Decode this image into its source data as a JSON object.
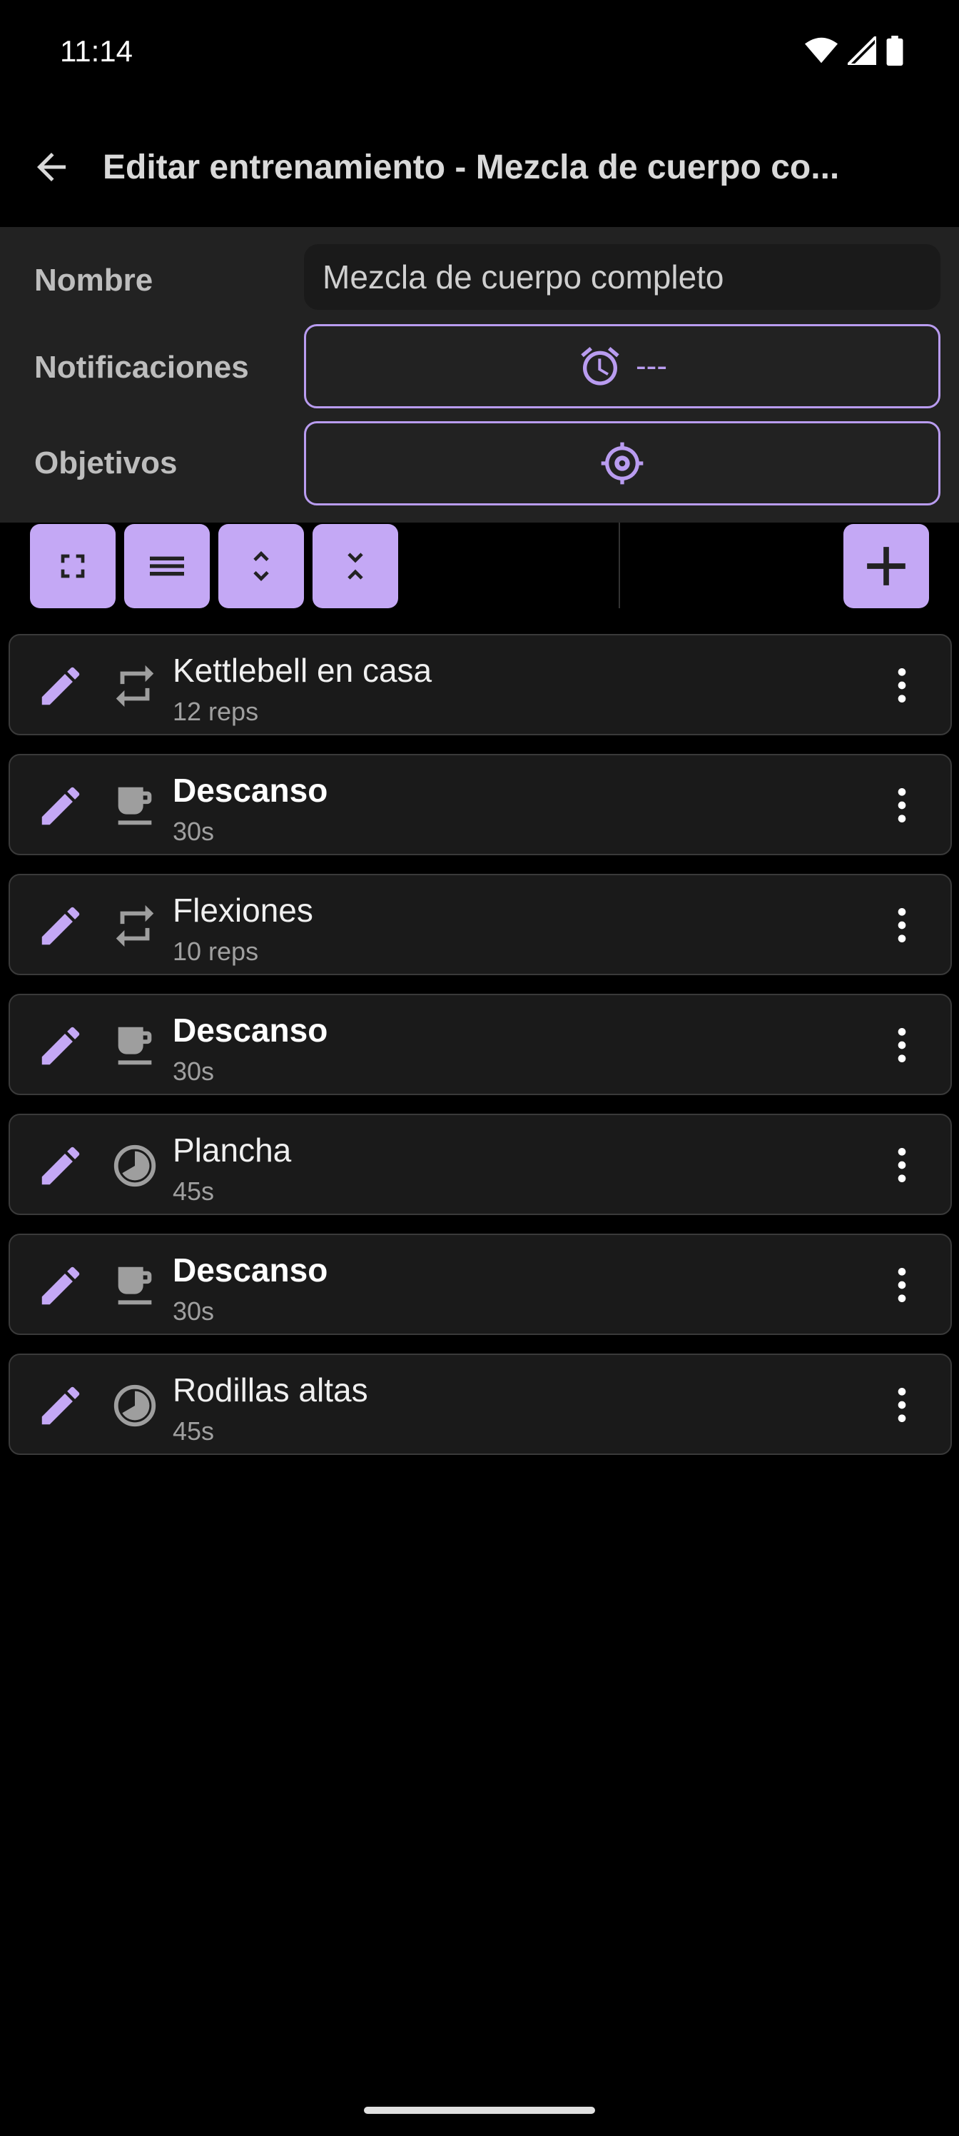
{
  "status": {
    "time": "11:14"
  },
  "app_bar": {
    "title": "Editar entrenamiento - Mezcla de cuerpo co..."
  },
  "form": {
    "name_label": "Nombre",
    "name_value": "Mezcla de cuerpo completo",
    "notifications_label": "Notificaciones",
    "notifications_value": "---",
    "goals_label": "Objetivos"
  },
  "colors": {
    "accent": "#b99cf0",
    "accent_fill": "#c4a8f5",
    "panel": "#222222",
    "row_bg": "#1a1a1a"
  },
  "exercises": [
    {
      "title": "Kettlebell en casa",
      "subtitle": "12 reps",
      "icon": "repeat-icon"
    },
    {
      "title": "Descanso",
      "subtitle": "30s",
      "icon": "cup-icon"
    },
    {
      "title": "Flexiones",
      "subtitle": "10 reps",
      "icon": "repeat-icon"
    },
    {
      "title": "Descanso",
      "subtitle": "30s",
      "icon": "cup-icon"
    },
    {
      "title": "Plancha",
      "subtitle": "45s",
      "icon": "timer-icon"
    },
    {
      "title": "Descanso",
      "subtitle": "30s",
      "icon": "cup-icon"
    },
    {
      "title": "Rodillas altas",
      "subtitle": "45s",
      "icon": "timer-icon"
    }
  ]
}
